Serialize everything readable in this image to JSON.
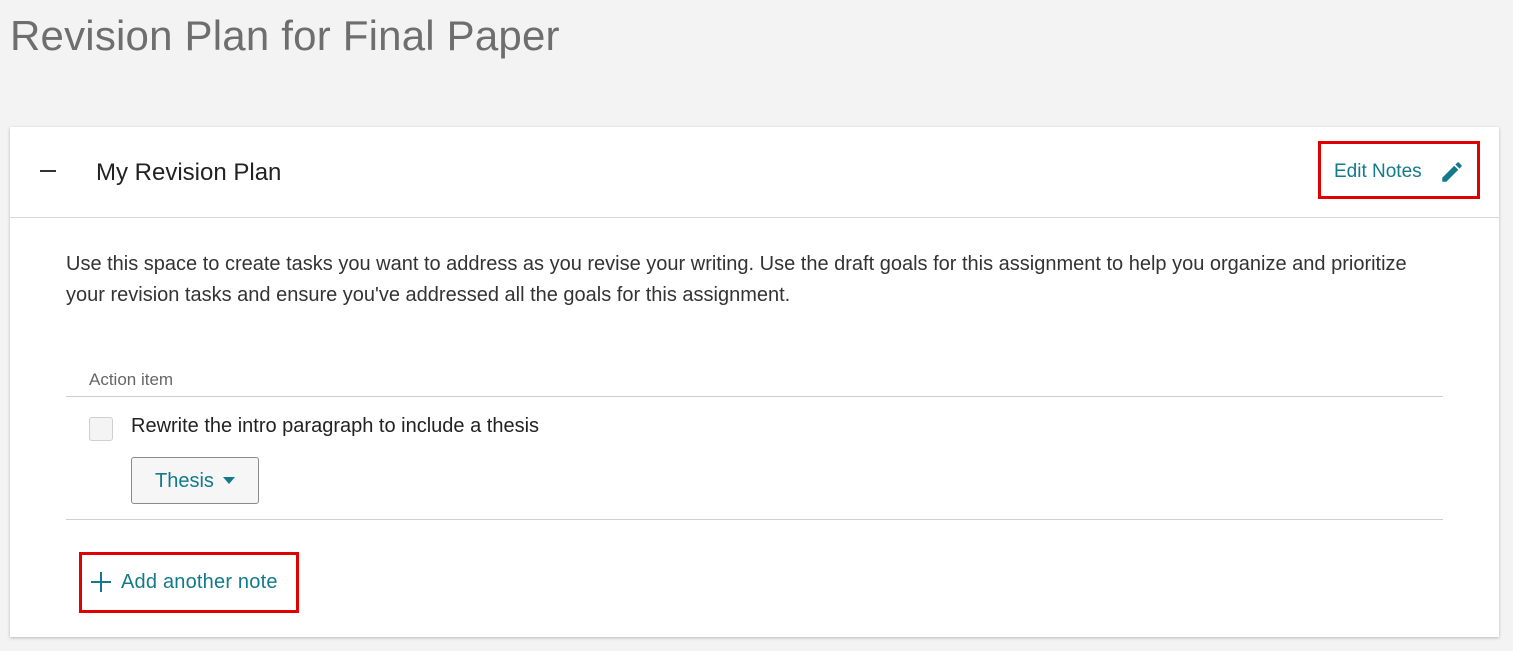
{
  "page": {
    "title": "Revision Plan for Final Paper"
  },
  "panel": {
    "collapse_icon": "minus-icon",
    "title": "My Revision Plan",
    "edit_notes_label": "Edit Notes",
    "edit_icon": "pencil-icon",
    "description": "Use this space to create tasks you want to address as you revise your writing. Use the draft goals for this assignment to help you organize and prioritize your revision tasks and ensure you've addressed all the goals for this assignment.",
    "table": {
      "column_header": "Action item",
      "rows": [
        {
          "checked": false,
          "text": "Rewrite the intro paragraph to include a thesis",
          "tag": "Thesis",
          "tag_icon": "caret-down-icon"
        }
      ]
    },
    "add_note_label": "Add another note",
    "add_icon": "plus-icon"
  },
  "colors": {
    "accent": "#127a8a",
    "highlight_border": "#e00000",
    "background": "#f3f3f3",
    "panel": "#ffffff"
  }
}
